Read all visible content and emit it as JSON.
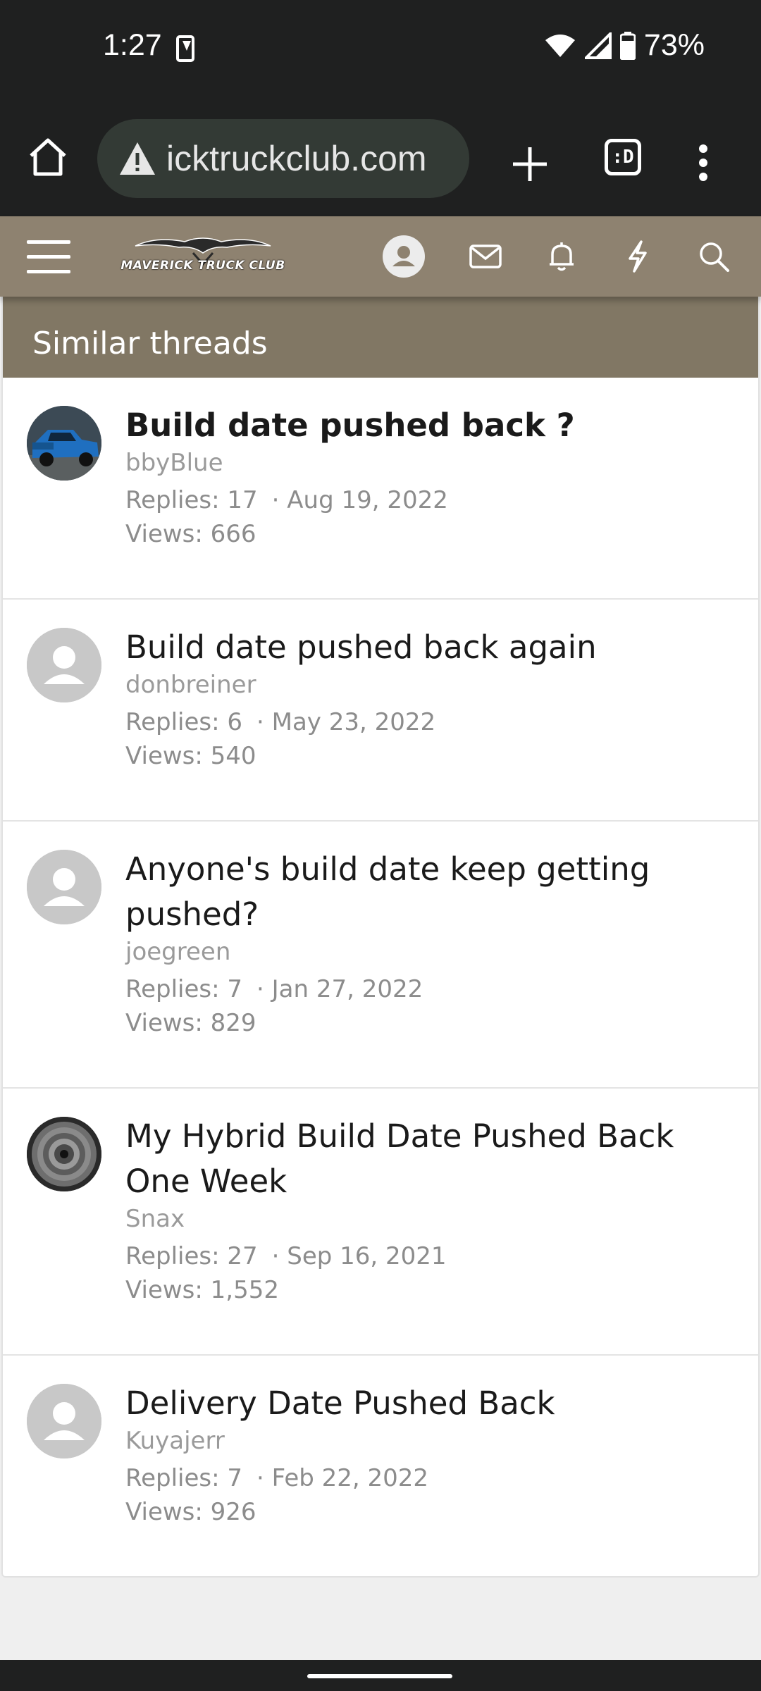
{
  "status_bar": {
    "time": "1:27",
    "battery": "73%"
  },
  "browser": {
    "url": "icktruckclub.com",
    "tab_count": ":D"
  },
  "site": {
    "logo_text": "MAVERICK TRUCK CLUB"
  },
  "panel": {
    "title": "Similar threads"
  },
  "threads": [
    {
      "title": "Build date pushed back ?",
      "author": "bbyBlue",
      "replies": "Replies: 17",
      "date": "· Aug 19, 2022",
      "views": "Views: 666"
    },
    {
      "title": "Build date pushed back again",
      "author": "donbreiner",
      "replies": "Replies: 6",
      "date": "· May 23, 2022",
      "views": "Views: 540"
    },
    {
      "title": "Anyone's build date keep getting pushed?",
      "author": "joegreen",
      "replies": "Replies: 7",
      "date": "· Jan 27, 2022",
      "views": "Views: 829"
    },
    {
      "title": "My Hybrid Build Date Pushed Back One Week",
      "author": "Snax",
      "replies": "Replies: 27",
      "date": "· Sep 16, 2021",
      "views": "Views: 1,552"
    },
    {
      "title": "Delivery Date Pushed Back",
      "author": "Kuyajerr",
      "replies": "Replies: 7",
      "date": "· Feb 22, 2022",
      "views": "Views: 926"
    }
  ],
  "colors": {
    "header_bg": "#8e8270",
    "panel_head_bg": "#817764",
    "system_bar": "#1f2020"
  }
}
